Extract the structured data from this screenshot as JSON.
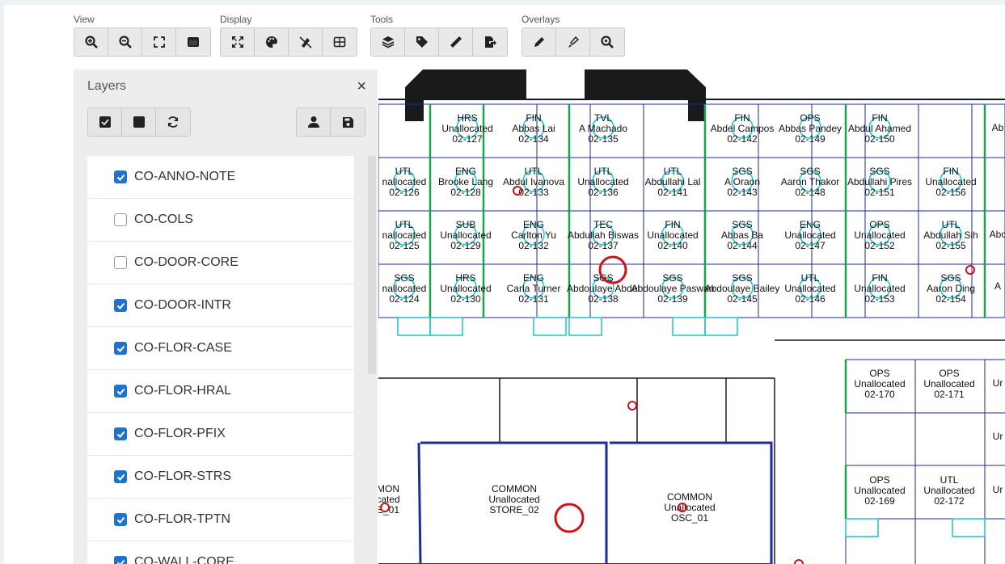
{
  "toolbar": {
    "groups": [
      {
        "label": "View",
        "buttons": [
          "zoom-in-icon",
          "zoom-out-icon",
          "fit-extent-icon",
          "window-icon"
        ]
      },
      {
        "label": "Display",
        "buttons": [
          "expand-icon",
          "palette-icon",
          "eye-slash-icon",
          "grid-icon"
        ]
      },
      {
        "label": "Tools",
        "buttons": [
          "layers-icon",
          "tag-icon",
          "ruler-icon",
          "export-icon"
        ]
      },
      {
        "label": "Overlays",
        "buttons": [
          "pencil-icon",
          "highlighter-icon",
          "search-zoom-icon"
        ]
      }
    ]
  },
  "layers_panel": {
    "title": "Layers",
    "close": "×",
    "items": [
      {
        "name": "CO-ANNO-NOTE",
        "checked": true
      },
      {
        "name": "CO-COLS",
        "checked": false
      },
      {
        "name": "CO-DOOR-CORE",
        "checked": false
      },
      {
        "name": "CO-DOOR-INTR",
        "checked": true
      },
      {
        "name": "CO-FLOR-CASE",
        "checked": true
      },
      {
        "name": "CO-FLOR-HRAL",
        "checked": true
      },
      {
        "name": "CO-FLOR-PFIX",
        "checked": true
      },
      {
        "name": "CO-FLOR-STRS",
        "checked": true
      },
      {
        "name": "CO-FLOR-TPTN",
        "checked": true
      },
      {
        "name": "CO-WALL-CORE",
        "checked": true
      }
    ]
  },
  "floorplan": {
    "rooms": [
      {
        "dept": "HRS",
        "occupant": "Unallocated",
        "id": "02-127"
      },
      {
        "dept": "FIN",
        "occupant": "Abbas Lai",
        "id": "02-134"
      },
      {
        "dept": "TVL",
        "occupant": "A Machado",
        "id": "02-135"
      },
      {
        "dept": "FIN",
        "occupant": "Abdel Campos",
        "id": "02-142"
      },
      {
        "dept": "OPS",
        "occupant": "Abbas Pandey",
        "id": "02-149"
      },
      {
        "dept": "FIN",
        "occupant": "Abdul Ahamed",
        "id": "02-150"
      },
      {
        "dept": "UTL",
        "occupant": "nallocated",
        "id": "02-126"
      },
      {
        "dept": "ENG",
        "occupant": "Brooke Lang",
        "id": "02-128"
      },
      {
        "dept": "UTL",
        "occupant": "Abdul Ivanova",
        "id": "02-133"
      },
      {
        "dept": "UTL",
        "occupant": "Unallocated",
        "id": "02-136"
      },
      {
        "dept": "UTL",
        "occupant": "Abdullahi Lal",
        "id": "02-141"
      },
      {
        "dept": "SGS",
        "occupant": "A Oraon",
        "id": "02-143"
      },
      {
        "dept": "SGS",
        "occupant": "Aaron Thakor",
        "id": "02-148"
      },
      {
        "dept": "SGS",
        "occupant": "Abdullahi Pires",
        "id": "02-151"
      },
      {
        "dept": "FIN",
        "occupant": "Unallocated",
        "id": "02-156"
      },
      {
        "dept": "UTL",
        "occupant": "nallocated",
        "id": "02-125"
      },
      {
        "dept": "SUB",
        "occupant": "Unallocated",
        "id": "02-129"
      },
      {
        "dept": "ENG",
        "occupant": "Carlton Yu",
        "id": "02-132"
      },
      {
        "dept": "TEC",
        "occupant": "Abdullah Biswas",
        "id": "02-137"
      },
      {
        "dept": "FIN",
        "occupant": "Unallocated",
        "id": "02-140"
      },
      {
        "dept": "SGS",
        "occupant": "Abbas Ba",
        "id": "02-144"
      },
      {
        "dept": "ENG",
        "occupant": "Unallocated",
        "id": "02-147"
      },
      {
        "dept": "OPS",
        "occupant": "Unallocated",
        "id": "02-152"
      },
      {
        "dept": "UTL",
        "occupant": "Abdullah Sih",
        "id": "02-155"
      },
      {
        "dept": "SGS",
        "occupant": "nallocated",
        "id": "02-124"
      },
      {
        "dept": "HRS",
        "occupant": "Unallocated",
        "id": "02-130"
      },
      {
        "dept": "ENG",
        "occupant": "Carla Turner",
        "id": "02-131"
      },
      {
        "dept": "SGS",
        "occupant": "Abdoulaye Abdel",
        "id": "02-138"
      },
      {
        "dept": "SGS",
        "occupant": "Abdoulaye Paswan",
        "id": "02-139"
      },
      {
        "dept": "SGS",
        "occupant": "Abdoulaye Bailey",
        "id": "02-145"
      },
      {
        "dept": "UTL",
        "occupant": "Unallocated",
        "id": "02-146"
      },
      {
        "dept": "FIN",
        "occupant": "Unallocated",
        "id": "02-153"
      },
      {
        "dept": "SGS",
        "occupant": "Aaron Ding",
        "id": "02-154"
      },
      {
        "dept": "OPS",
        "occupant": "Unallocated",
        "id": "02-170"
      },
      {
        "dept": "OPS",
        "occupant": "Unallocated",
        "id": "02-171"
      },
      {
        "dept": "OPS",
        "occupant": "Unallocated",
        "id": "02-169"
      },
      {
        "dept": "UTL",
        "occupant": "Unallocated",
        "id": "02-172"
      },
      {
        "dept": "COMMON",
        "occupant": "Unallocated",
        "id": "STORE_02"
      },
      {
        "dept": "COMMON",
        "occupant": "Unallocated",
        "id": "OSC_01"
      },
      {
        "dept": "MON",
        "occupant": "cated",
        "id": "E_01"
      }
    ],
    "edge_labels": [
      "Ab",
      "A",
      "Ur",
      "Ur",
      "Ur",
      "Abc"
    ],
    "colors": {
      "wall": "#1a1a1a",
      "partition": "#1e2b9e",
      "column": "#1aa34a",
      "desk": "#19c6d6",
      "marker": "#d0101a"
    }
  }
}
